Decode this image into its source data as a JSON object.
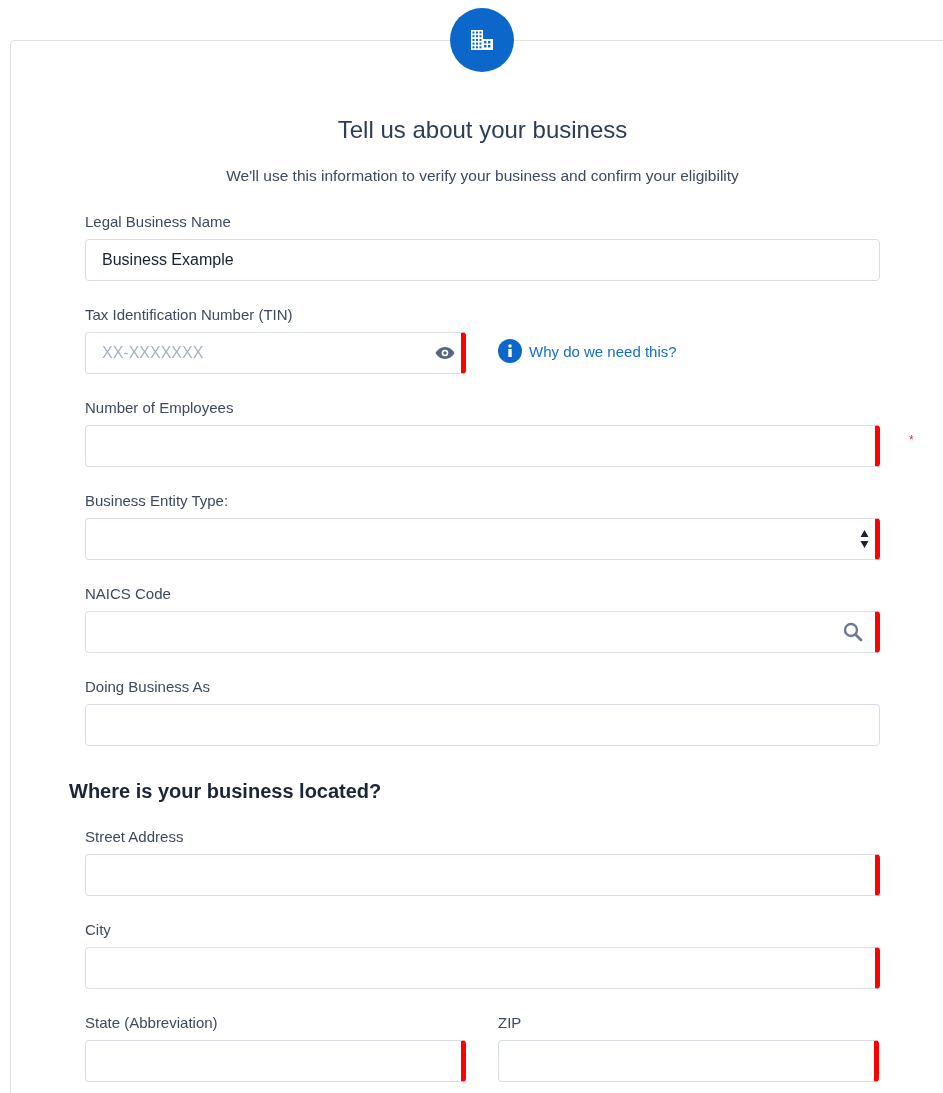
{
  "header": {
    "title": "Tell us about your business",
    "subtitle": "We'll use this information to verify your business and confirm your eligibility"
  },
  "business_fields": [
    {
      "label": "Legal Business Name",
      "kind": "text",
      "value": "Business Example",
      "required": false,
      "half": false
    },
    {
      "label": "Tax Identification Number (TIN)",
      "kind": "secret",
      "placeholder": "XX-XXXXXXX",
      "required": true,
      "half": true,
      "help_link": "Why do we need this?"
    },
    {
      "label": "Number of Employees",
      "kind": "text",
      "required": true,
      "half": false,
      "asterisk": "*"
    },
    {
      "label": "Business Entity Type:",
      "kind": "select",
      "required": true,
      "half": false
    },
    {
      "label": "NAICS Code",
      "kind": "search",
      "required": true,
      "half": false
    },
    {
      "label": "Doing Business As",
      "kind": "text",
      "required": false,
      "half": false
    }
  ],
  "location": {
    "heading": "Where is your business located?",
    "fields": [
      {
        "label": "Street Address",
        "kind": "text",
        "required": true,
        "half": false
      },
      {
        "label": "City",
        "kind": "text",
        "required": true,
        "half": false
      },
      {
        "label": "State (Abbreviation)",
        "kind": "text",
        "required": true,
        "half": true
      },
      {
        "label": "ZIP",
        "kind": "text",
        "required": true,
        "half": true
      }
    ]
  }
}
